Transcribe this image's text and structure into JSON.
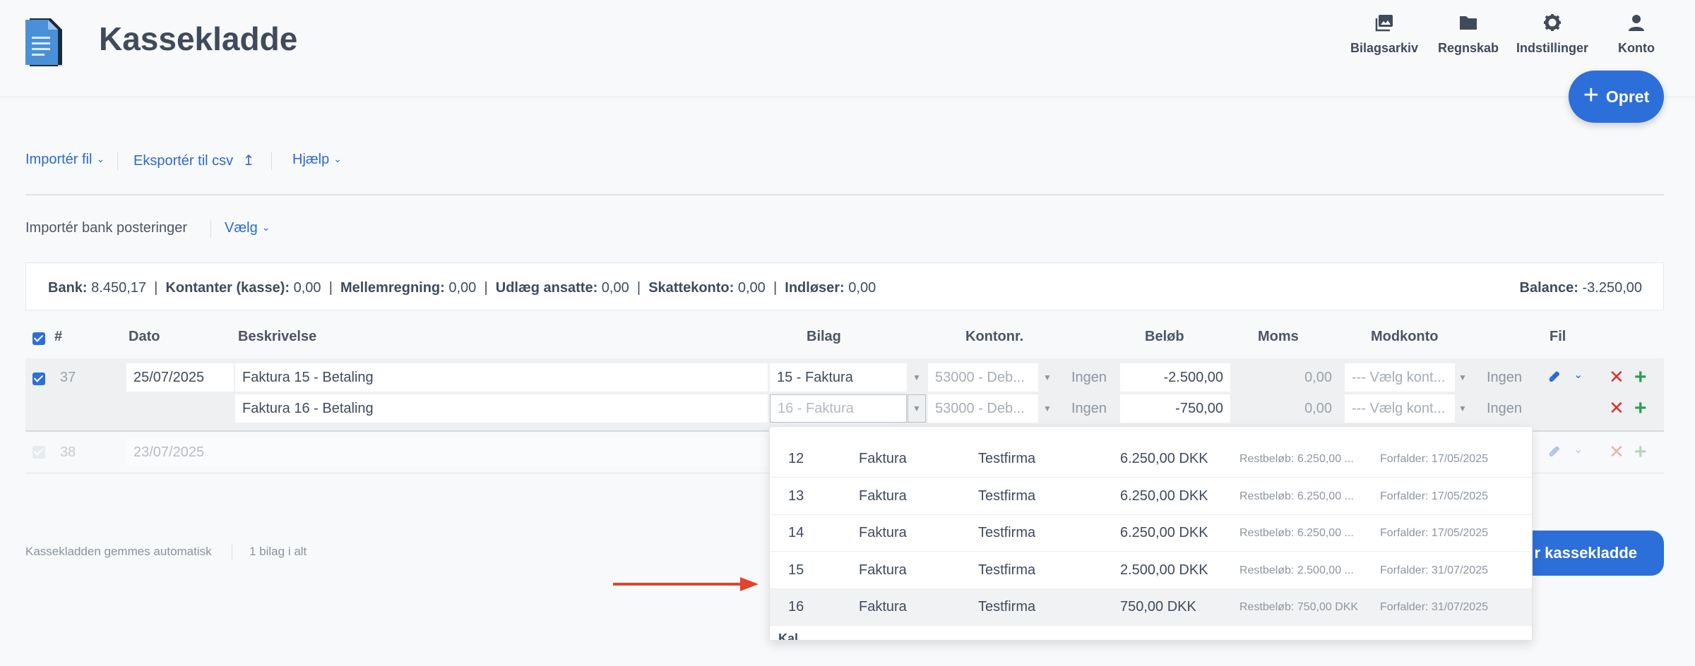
{
  "app": {
    "title": "Kassekladde"
  },
  "nav": [
    {
      "label": "Bilagsarkiv",
      "icon": "photo-library-icon"
    },
    {
      "label": "Regnskab",
      "icon": "folder-icon"
    },
    {
      "label": "Indstillinger",
      "icon": "gear-icon"
    },
    {
      "label": "Konto",
      "icon": "user-icon"
    }
  ],
  "create_button": {
    "label": "Opret",
    "icon": "plus-icon"
  },
  "toolbar": {
    "import_file": "Importér fil",
    "export_csv": "Eksportér til csv",
    "export_icon": "↥",
    "help": "Hjælp",
    "bank_import_label": "Importér bank posteringer",
    "bank_import_select": "Vælg"
  },
  "summary": {
    "items": [
      {
        "label": "Bank:",
        "value": "8.450,17"
      },
      {
        "label": "Kontanter (kasse):",
        "value": "0,00"
      },
      {
        "label": "Mellemregning:",
        "value": "0,00"
      },
      {
        "label": "Udlæg ansatte:",
        "value": "0,00"
      },
      {
        "label": "Skattekonto:",
        "value": "0,00"
      },
      {
        "label": "Indløser:",
        "value": "0,00"
      }
    ],
    "separator": "|",
    "balance_label": "Balance:",
    "balance_value": "-3.250,00"
  },
  "table": {
    "columns": {
      "number": "#",
      "date": "Dato",
      "description": "Beskrivelse",
      "voucher": "Bilag",
      "account": "Kontonr.",
      "amount": "Beløb",
      "vat": "Moms",
      "counter_account": "Modkonto",
      "file": "Fil"
    },
    "rows": [
      {
        "number": "37",
        "date": "25/07/2025",
        "lines": [
          {
            "description": "Faktura 15 - Betaling",
            "voucher": "15 - Faktura",
            "account": "53000 - Deb...",
            "vat_code": "Ingen",
            "amount": "-2.500,00",
            "vat": "0,00",
            "counter_account": "--- Vælg kont...",
            "counter_vat": "Ingen"
          },
          {
            "description": "Faktura 16 - Betaling",
            "voucher": "16 - Faktura",
            "account": "53000 - Deb...",
            "vat_code": "Ingen",
            "amount": "-750,00",
            "vat": "0,00",
            "counter_account": "--- Vælg kont...",
            "counter_vat": "Ingen"
          }
        ]
      },
      {
        "number": "38",
        "date": "23/07/2025"
      }
    ]
  },
  "footer": {
    "autosave": "Kassekladden gemmes automatisk",
    "voucher_count": "1 bilag i alt",
    "save_button": "r kassekladde"
  },
  "dropdown": {
    "options": [
      {
        "number": "12",
        "type": "Faktura",
        "company": "Testfirma",
        "amount": "6.250,00 DKK",
        "remaining": "Restbeløb: 6.250,00 ...",
        "due": "Forfalder: 17/05/2025"
      },
      {
        "number": "13",
        "type": "Faktura",
        "company": "Testfirma",
        "amount": "6.250,00 DKK",
        "remaining": "Restbeløb: 6.250,00 ...",
        "due": "Forfalder: 17/05/2025"
      },
      {
        "number": "14",
        "type": "Faktura",
        "company": "Testfirma",
        "amount": "6.250,00 DKK",
        "remaining": "Restbeløb: 6.250,00 ...",
        "due": "Forfalder: 17/05/2025"
      },
      {
        "number": "15",
        "type": "Faktura",
        "company": "Testfirma",
        "amount": "2.500,00 DKK",
        "remaining": "Restbeløb: 2.500,00 ...",
        "due": "Forfalder: 31/07/2025"
      },
      {
        "number": "16",
        "type": "Faktura",
        "company": "Testfirma",
        "amount": "750,00 DKK",
        "remaining": "Restbeløb: 750,00 DKK",
        "due": "Forfalder: 31/07/2025"
      }
    ],
    "partial_group_label": "Kal"
  },
  "colors": {
    "accent": "#2d6fd8",
    "delete": "#d9332a",
    "add": "#2f9e53",
    "annotation_arrow": "#e2432e"
  }
}
